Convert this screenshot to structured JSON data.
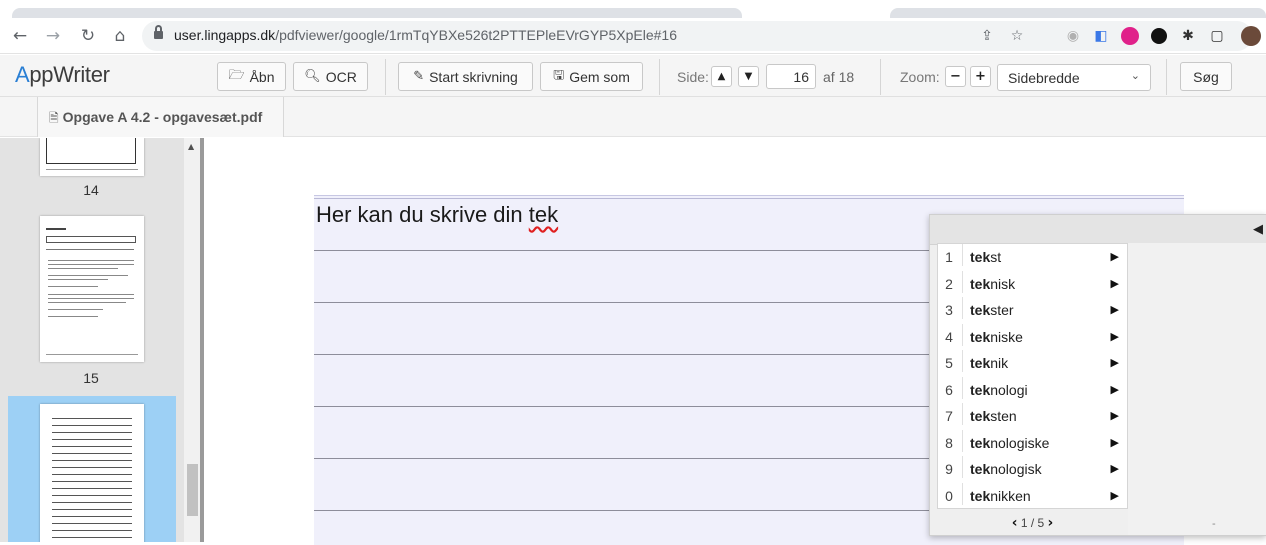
{
  "browser": {
    "url_host": "user.lingapps.dk",
    "url_path": "/pdfviewer/google/1rmTqYBXe526t2PTTEPleEVrGYP5XpEle#16",
    "nav_icons": [
      "back-arrow-icon",
      "forward-arrow-icon",
      "reload-icon",
      "home-icon"
    ],
    "ext_icons": [
      "share-icon",
      "star-icon",
      "extension-icon-1",
      "extension-icon-2",
      "extension-icon-3",
      "extension-icon-4",
      "puzzle-icon",
      "window-icon",
      "profile-avatar"
    ]
  },
  "app": {
    "logo_first": "A",
    "logo_rest": "ppWriter",
    "open_label": "Åbn",
    "ocr_label": "OCR",
    "start_writing_label": "Start skrivning",
    "save_as_label": "Gem som",
    "page_label": "Side:",
    "current_page": "16",
    "page_total": "af 18",
    "zoom_label": "Zoom:",
    "zoom_value": "Sidebredde",
    "search_label": "Søg"
  },
  "document": {
    "tab_title": "Opgave A 4.2 - opgavesæt.pdf"
  },
  "thumbnails": {
    "numbers": [
      "14",
      "15"
    ],
    "selected_page": "16"
  },
  "editor": {
    "text_before": "Her kan du skrive din ",
    "text_typo": "tek"
  },
  "prediction": {
    "typed_prefix": "tek",
    "items": [
      {
        "n": "1",
        "word": "tekst"
      },
      {
        "n": "2",
        "word": "teknisk"
      },
      {
        "n": "3",
        "word": "tekster"
      },
      {
        "n": "4",
        "word": "tekniske"
      },
      {
        "n": "5",
        "word": "teknik"
      },
      {
        "n": "6",
        "word": "teknologi"
      },
      {
        "n": "7",
        "word": "teksten"
      },
      {
        "n": "8",
        "word": "teknologiske"
      },
      {
        "n": "9",
        "word": "teknologisk"
      },
      {
        "n": "0",
        "word": "teknikken"
      }
    ],
    "pager": "1 / 5",
    "right_panel_dash": "-"
  },
  "colors": {
    "logo_accent": "#2a7fd4",
    "selected_thumb": "#9dd0f5",
    "page_background": "#f0f0fb",
    "spell_error": "#e02020"
  }
}
